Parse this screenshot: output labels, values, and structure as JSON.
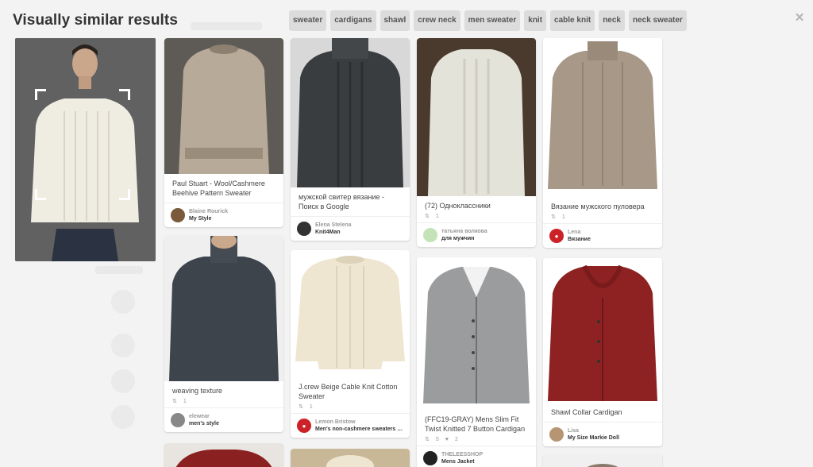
{
  "header": {
    "title": "Visually similar results",
    "close_glyph": "×"
  },
  "chips": [
    "sweater",
    "cardigans",
    "shawl",
    "crew neck",
    "men sweater",
    "knit",
    "cable knit",
    "neck",
    "neck sweater"
  ],
  "query": {
    "sweater_color": "#efece1"
  },
  "pins": [
    {
      "desc": "Paul Stuart - Wool/Cashmere Beehive Pattern Sweater",
      "name": "Blaine Rourick",
      "board": "My Style",
      "avatar_color": "#7a5a3a",
      "color": "#b8aa98"
    },
    {
      "desc": "weaving texture",
      "saves": "1",
      "name": "elewear",
      "board": "men's style",
      "avatar_color": "#888888",
      "color": "#3e444c"
    },
    {
      "desc": "мужской свитер вязание - Поиск в Google",
      "name": "Elena Stelena",
      "board": "Knit4Man",
      "avatar_color": "#333333",
      "color": "#3a3d40"
    },
    {
      "desc": "J.crew Beige Cable Knit Cotton Sweater",
      "saves": "1",
      "name": "Lemon Bristow",
      "board": "Men's non-cashmere sweaters (...",
      "avatar_color": "#cc2127",
      "color": "#efe6d2"
    },
    {
      "desc": "(72) Одноклассники",
      "saves": "1",
      "name": "татьяна волкова",
      "board": "для мужчин",
      "avatar_color": "#c4e3b8",
      "color": "#e4e3da"
    },
    {
      "desc": "(FFC19-GRAY) Mens Slim Fit Twist Knitted 7 Button Cardigan",
      "saves": "5",
      "likes": "2",
      "name": "THELEESSHOP",
      "board": "Mens Jacket",
      "avatar_color": "#222222",
      "color": "#9a9c9e"
    },
    {
      "desc": "Вязание мужского пуловера",
      "saves": "1",
      "name": "Lena",
      "board": "Вязание",
      "avatar_color": "#cc2127",
      "color": "#a89888"
    },
    {
      "desc": "Shawl Collar Cardigan",
      "name": "Lisa",
      "board": "My Size Markie Doll",
      "avatar_color": "#b59572",
      "color": "#8e2222"
    }
  ]
}
